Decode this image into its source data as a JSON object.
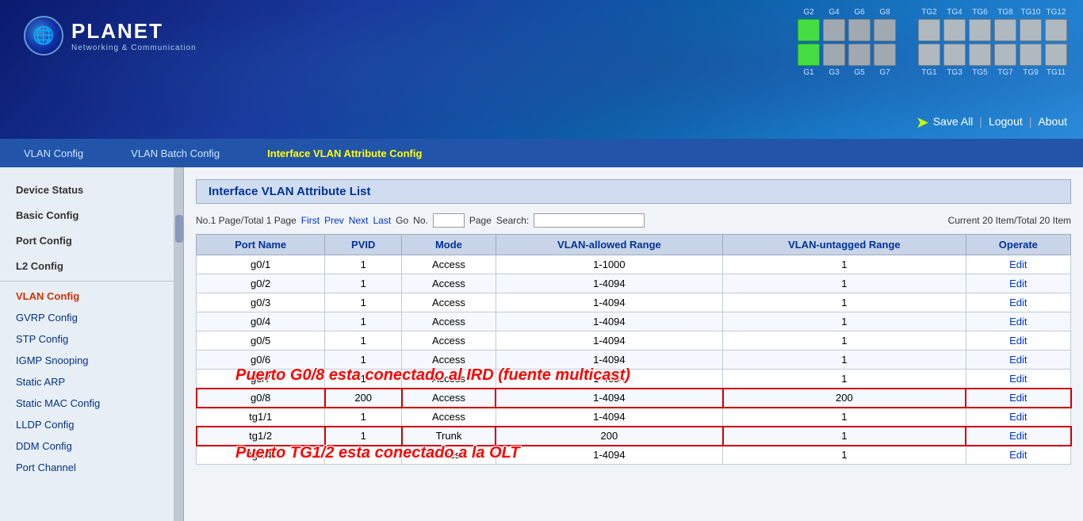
{
  "header": {
    "logo_brand": "PLANET",
    "logo_sub": "Networking & Communication",
    "top_nav": {
      "save_all": "Save All",
      "logout": "Logout",
      "about": "About"
    }
  },
  "ports_top": {
    "labels": [
      "G2",
      "G4",
      "G6",
      "G8",
      "TG2",
      "TG4",
      "TG6",
      "TG8",
      "TG10",
      "TG12"
    ],
    "active": [
      0
    ]
  },
  "ports_bottom": {
    "labels": [
      "G1",
      "G3",
      "G5",
      "G7",
      "TG1",
      "TG3",
      "TG5",
      "TG7",
      "TG9",
      "TG11"
    ],
    "active": [
      0
    ]
  },
  "menu": {
    "items": [
      {
        "label": "VLAN Config",
        "active": false
      },
      {
        "label": "VLAN Batch Config",
        "active": false
      },
      {
        "label": "Interface VLAN Attribute Config",
        "active": true
      }
    ]
  },
  "sidebar": {
    "items": [
      {
        "label": "Device Status",
        "type": "section",
        "active": false
      },
      {
        "label": "Basic Config",
        "type": "section",
        "active": false
      },
      {
        "label": "Port Config",
        "type": "section",
        "active": false
      },
      {
        "label": "L2 Config",
        "type": "section",
        "active": true
      },
      {
        "label": "VLAN Config",
        "type": "item",
        "active": true
      },
      {
        "label": "GVRP Config",
        "type": "item",
        "active": false
      },
      {
        "label": "STP Config",
        "type": "item",
        "active": false
      },
      {
        "label": "IGMP Snooping",
        "type": "item",
        "active": false
      },
      {
        "label": "Static ARP",
        "type": "item",
        "active": false
      },
      {
        "label": "Static MAC Config",
        "type": "item",
        "active": false
      },
      {
        "label": "LLDP Config",
        "type": "item",
        "active": false
      },
      {
        "label": "DDM Config",
        "type": "item",
        "active": false
      },
      {
        "label": "Port Channel",
        "type": "item",
        "active": false
      }
    ]
  },
  "content": {
    "title": "Interface VLAN Attribute List",
    "pagination": {
      "page_info": "No.1 Page/Total 1 Page",
      "first": "First",
      "prev": "Prev",
      "next": "Next",
      "last": "Last",
      "go": "Go",
      "no_label": "No.",
      "page_label": "Page",
      "search_label": "Search:",
      "current_info": "Current 20 Item/Total 20 Item"
    },
    "table": {
      "headers": [
        "Port Name",
        "PVID",
        "Mode",
        "VLAN-allowed Range",
        "VLAN-untagged Range",
        "Operate"
      ],
      "rows": [
        {
          "port": "g0/1",
          "pvid": "1",
          "mode": "Access",
          "allowed": "1-1000",
          "untagged": "1",
          "op": "Edit"
        },
        {
          "port": "g0/2",
          "pvid": "1",
          "mode": "Access",
          "allowed": "1-4094",
          "untagged": "1",
          "op": "Edit"
        },
        {
          "port": "g0/3",
          "pvid": "1",
          "mode": "Access",
          "allowed": "1-4094",
          "untagged": "1",
          "op": "Edit"
        },
        {
          "port": "g0/4",
          "pvid": "1",
          "mode": "Access",
          "allowed": "1-4094",
          "untagged": "1",
          "op": "Edit"
        },
        {
          "port": "g0/5",
          "pvid": "1",
          "mode": "Access",
          "allowed": "1-4094",
          "untagged": "1",
          "op": "Edit"
        },
        {
          "port": "g0/6",
          "pvid": "1",
          "mode": "Access",
          "allowed": "1-4094",
          "untagged": "1",
          "op": "Edit"
        },
        {
          "port": "g0/7",
          "pvid": "1",
          "mode": "Access",
          "allowed": "1-4094",
          "untagged": "1",
          "op": "Edit",
          "annotation_above": "Puerto G0/8 esta conectado al IRD (fuente multicast)"
        },
        {
          "port": "g0/8",
          "pvid": "200",
          "mode": "Access",
          "allowed": "1-4094",
          "untagged": "200",
          "op": "Edit",
          "highlight": true
        },
        {
          "port": "tg1/1",
          "pvid": "1",
          "mode": "Access",
          "allowed": "1-4094",
          "untagged": "1",
          "op": "Edit"
        },
        {
          "port": "tg1/2",
          "pvid": "1",
          "mode": "Trunk",
          "allowed": "200",
          "untagged": "1",
          "op": "Edit",
          "highlight": true,
          "annotation_below": "Puerto TG1/2 esta conectado a la OLT"
        },
        {
          "port": "tg1/3",
          "pvid": "1",
          "mode": "Access",
          "allowed": "1-4094",
          "untagged": "1",
          "op": "Edit"
        }
      ]
    }
  },
  "annotations": {
    "multicast": "Puerto G0/8 esta conectado al IRD (fuente multicast)",
    "olt": "Puerto TG1/2 esta conectado a la OLT"
  }
}
